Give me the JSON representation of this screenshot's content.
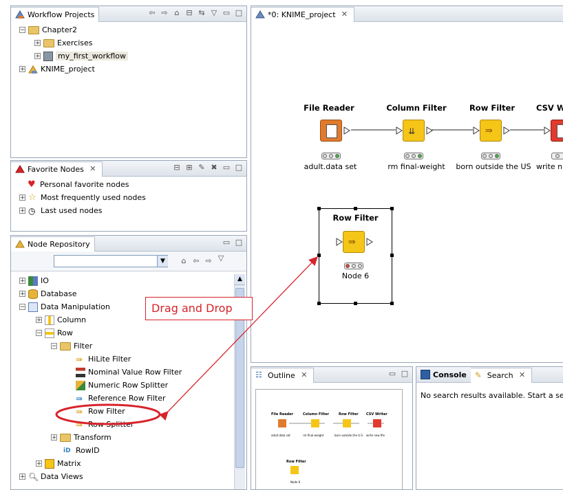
{
  "workflow_projects": {
    "tab_label": "Workflow Projects",
    "items": [
      {
        "label": "Chapter2"
      },
      {
        "label": "Exercises"
      },
      {
        "label": "my_first_workflow"
      },
      {
        "label": "KNIME_project"
      }
    ]
  },
  "editor": {
    "tab_label": "*0: KNIME_project",
    "nodes": [
      {
        "title": "File Reader",
        "label": "adult.data set"
      },
      {
        "title": "Column Filter",
        "label": "rm final-weight"
      },
      {
        "title": "Row Filter",
        "label": "born outside the US"
      },
      {
        "title": "CSV W",
        "label": "write n"
      }
    ],
    "new_node": {
      "title": "Row Filter",
      "label": "Node 6"
    }
  },
  "favorite_nodes": {
    "tab_label": "Favorite Nodes",
    "items": [
      {
        "label": "Personal favorite nodes"
      },
      {
        "label": "Most frequently used nodes"
      },
      {
        "label": "Last used nodes"
      }
    ]
  },
  "node_repository": {
    "tab_label": "Node Repository",
    "search_value": "",
    "items": [
      {
        "label": "IO"
      },
      {
        "label": "Database"
      },
      {
        "label": "Data Manipulation"
      },
      {
        "label": "Column"
      },
      {
        "label": "Row"
      },
      {
        "label": "Filter"
      },
      {
        "label": "HiLite Filter"
      },
      {
        "label": "Nominal Value Row Filter"
      },
      {
        "label": "Numeric Row Splitter"
      },
      {
        "label": "Reference Row Filter"
      },
      {
        "label": "Row Filter"
      },
      {
        "label": "Row Splitter"
      },
      {
        "label": "Transform"
      },
      {
        "label": "RowID"
      },
      {
        "label": "Matrix"
      },
      {
        "label": "Data Views"
      }
    ]
  },
  "outline": {
    "tab_label": "Outline",
    "mini_nodes": [
      {
        "title": "File Reader",
        "label": "adult.data set"
      },
      {
        "title": "Column Filter",
        "label": "rm final-weight"
      },
      {
        "title": "Row Filter",
        "label": "born outside the U.S."
      },
      {
        "title": "CSV Writer",
        "label": "write new file"
      }
    ],
    "mini_new_node": {
      "title": "Row Filter",
      "label": "Node 6"
    }
  },
  "console": {
    "console_tab_label": "Console",
    "search_tab_label": "Search",
    "message": "No search results available. Start a se"
  },
  "annotation": {
    "text": "Drag and Drop"
  },
  "colors": {
    "accent_red": "#d8232a",
    "node_orange": "#e07b2e",
    "node_yellow": "#f5c518",
    "node_red": "#e23b2e"
  }
}
